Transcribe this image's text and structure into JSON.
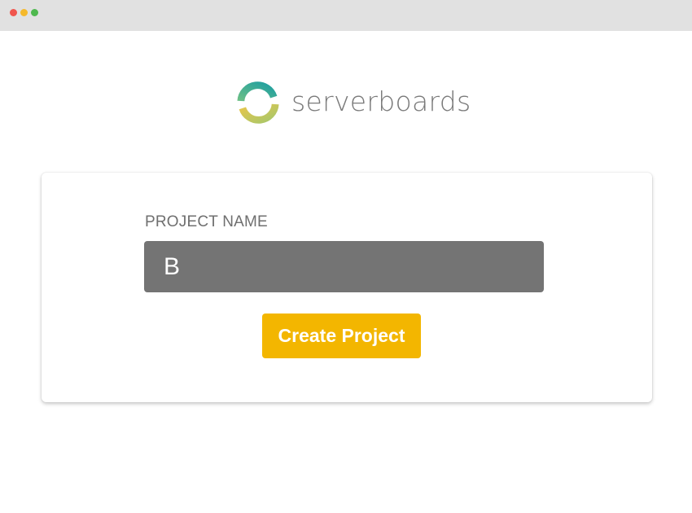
{
  "window": {
    "controls": [
      "close",
      "minimize",
      "maximize"
    ]
  },
  "brand": {
    "name": "serverboards",
    "logo_icon": "serverboards-logo-icon",
    "colors": {
      "teal": "#2aa79a",
      "yellow": "#e4c24e",
      "green": "#7cc07e",
      "text": "#7a7a7a"
    }
  },
  "form": {
    "project_name_label": "PROJECT NAME",
    "project_name_value": "B",
    "submit_label": "Create Project"
  },
  "theme": {
    "input_bg": "#747474",
    "button_bg": "#f3b600",
    "titlebar_bg": "#e1e1e1"
  }
}
